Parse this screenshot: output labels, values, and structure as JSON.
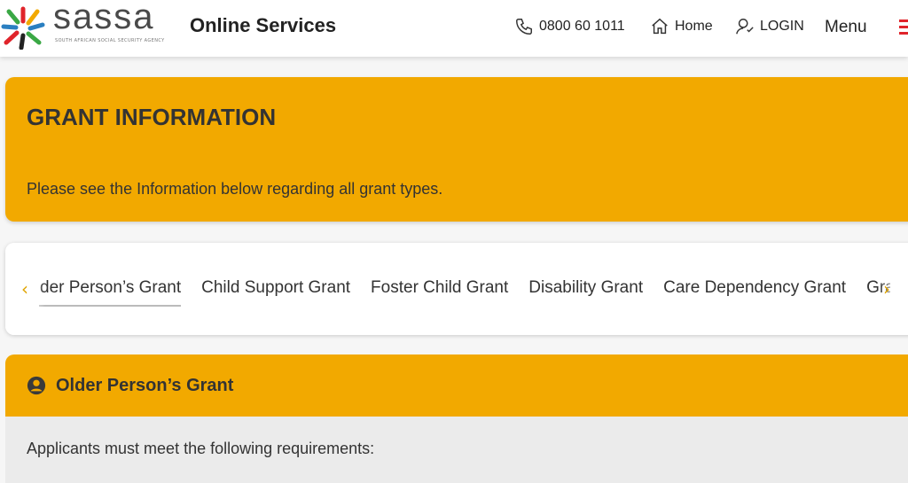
{
  "header": {
    "logo_text": "sassa",
    "logo_tagline": "SOUTH AFRICAN SOCIAL SECURITY AGENCY",
    "site_title": "Online Services",
    "phone": "0800 60 1011",
    "home_label": "Home",
    "login_label": "LOGIN",
    "menu_label": "Menu"
  },
  "banner": {
    "title": "GRANT INFORMATION",
    "subtitle": "Please see the Information below regarding all grant types."
  },
  "tabs": {
    "items": [
      {
        "label": "Older Person’s Grant",
        "active": true
      },
      {
        "label": "Child Support Grant",
        "active": false
      },
      {
        "label": "Foster Child Grant",
        "active": false
      },
      {
        "label": "Disability Grant",
        "active": false
      },
      {
        "label": "Care Dependency Grant",
        "active": false
      },
      {
        "label": "Grant-in-Aid",
        "active": false
      }
    ],
    "prev_icon": "chevron-left-icon",
    "next_icon": "chevron-right-icon"
  },
  "grant": {
    "icon": "person-circle-icon",
    "title": "Older Person’s Grant",
    "requirements_intro": "Applicants must meet the following requirements:"
  },
  "colors": {
    "accent": "#f2a900",
    "menu_red": "#e0242b",
    "text": "#333333"
  }
}
